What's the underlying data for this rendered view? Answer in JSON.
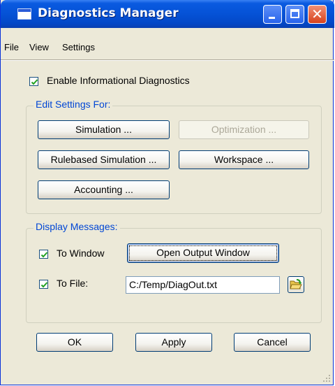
{
  "window": {
    "title": "Diagnostics Manager",
    "icons": [
      "app-icon",
      "minimize-icon",
      "maximize-icon",
      "close-icon"
    ]
  },
  "menu": {
    "file": "File",
    "view": "View",
    "settings": "Settings"
  },
  "enable_diagnostics": {
    "label": "Enable Informational Diagnostics",
    "checked": true
  },
  "edit_settings": {
    "legend": "Edit Settings For:",
    "simulation": "Simulation ...",
    "optimization": "Optimization ...",
    "rulebased": "Rulebased Simulation ...",
    "workspace": "Workspace ...",
    "accounting": "Accounting ..."
  },
  "display_messages": {
    "legend": "Display Messages:",
    "to_window_label": "To Window",
    "to_window_checked": true,
    "open_output_button": "Open Output Window",
    "to_file_label": "To File:",
    "to_file_checked": true,
    "file_path": "C:/Temp/DiagOut.txt",
    "browse_icon": "open-folder-icon"
  },
  "footer": {
    "ok": "OK",
    "apply": "Apply",
    "cancel": "Cancel"
  },
  "colors": {
    "title_bar": "#0552d6",
    "close_button": "#d8421c",
    "group_legend": "#0046d5",
    "dialog_bg": "#ece9d8"
  }
}
